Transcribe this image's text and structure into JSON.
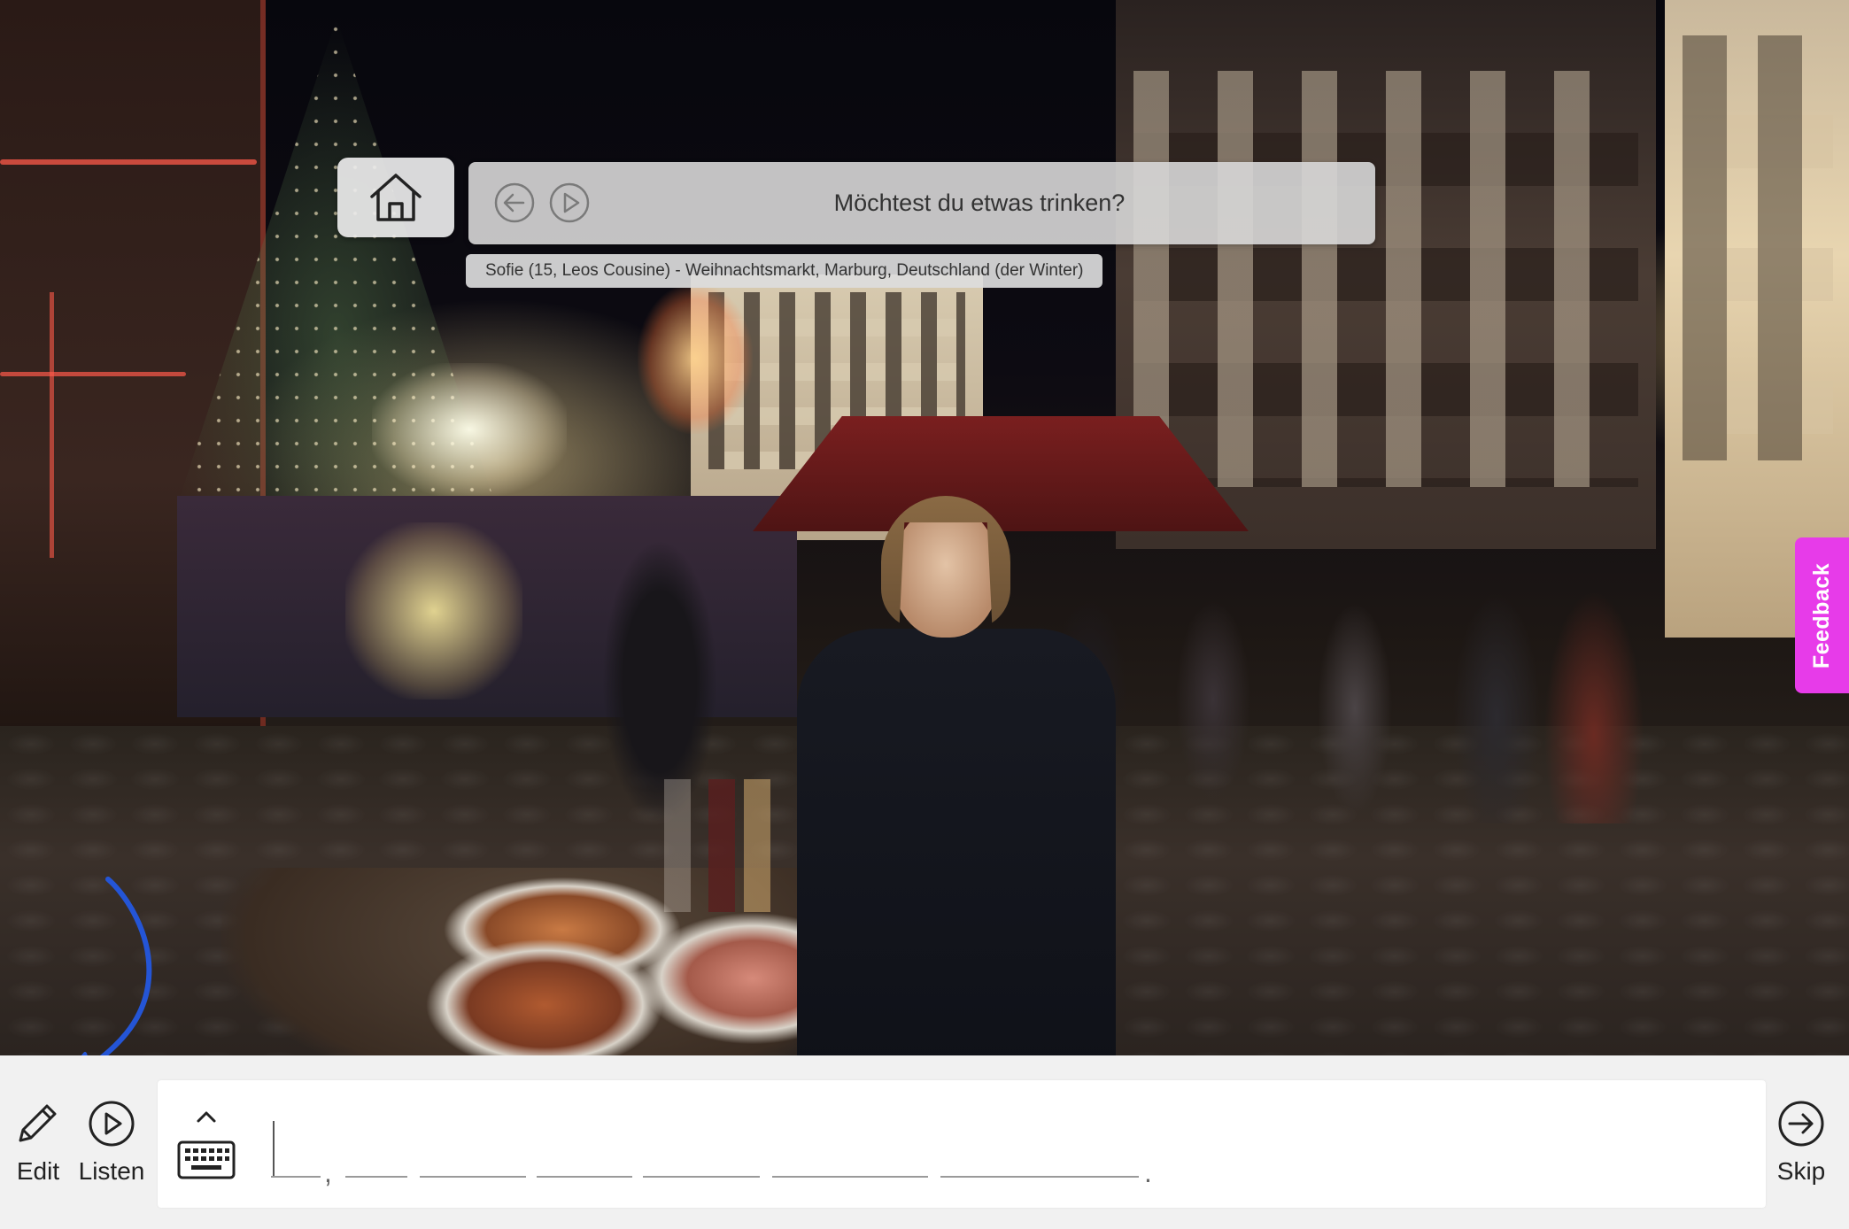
{
  "scene": {
    "prompt": {
      "text": "Möchtest du etwas trinken?",
      "back_icon": "arrow-left-circle-icon",
      "play_icon": "play-circle-icon"
    },
    "caption": "Sofie (15, Leos Cousine) - Weihnachtsmarkt, Marburg, Deutschland (der Winter)",
    "home_icon": "home-icon"
  },
  "feedback": {
    "label": "Feedback",
    "color": "#e73be9"
  },
  "toolbar": {
    "edit_label": "Edit",
    "edit_icon": "pencil-icon",
    "listen_label": "Listen",
    "listen_icon": "play-circle-icon",
    "skip_label": "Skip",
    "skip_icon": "arrow-right-circle-icon",
    "keyboard_icon": "keyboard-icon",
    "annotation_color": "#2455d6"
  },
  "answer": {
    "blank_count": 7,
    "punctuation": [
      ",",
      "."
    ]
  }
}
